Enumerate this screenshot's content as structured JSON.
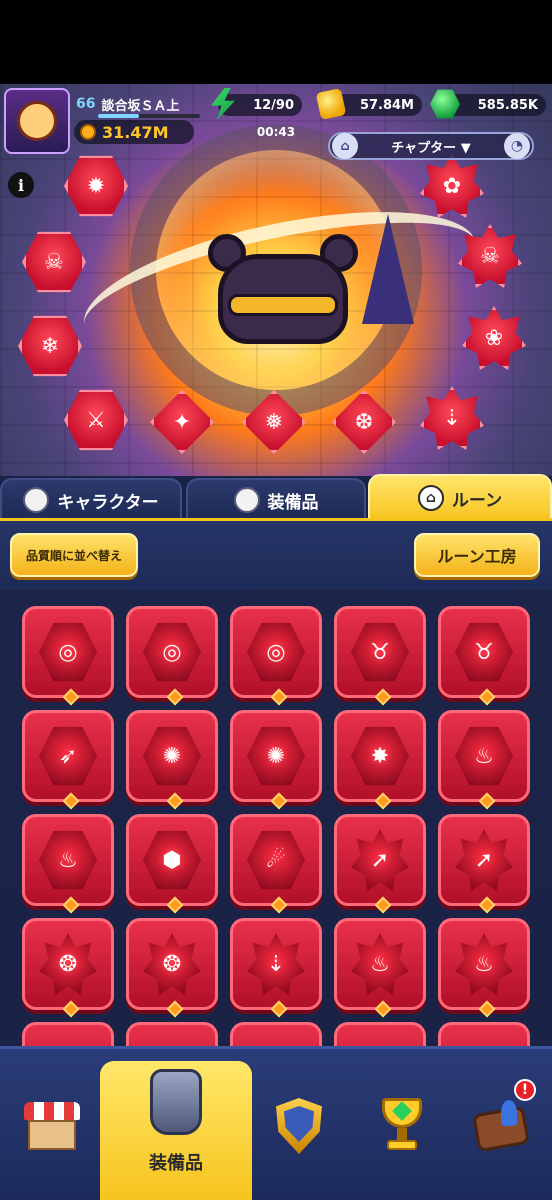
{
  "player": {
    "level": "66",
    "name": "談合坂ＳＡ上",
    "power": "31.47M"
  },
  "resources": {
    "energy": "12/90",
    "coins": "57.84M",
    "gems": "585.85K"
  },
  "timer": "00:43",
  "chapter_selector": {
    "label": "チャプター"
  },
  "tabs": [
    {
      "label": "キャラクター",
      "active": false
    },
    {
      "label": "装備品",
      "active": false
    },
    {
      "label": "ルーン",
      "active": true
    }
  ],
  "toolbar": {
    "sort_label": "品質順に並べ替え",
    "workshop_label": "ルーン工房"
  },
  "bottom_nav": {
    "items": [
      {
        "id": "shop",
        "icon": "shop-icon",
        "label": ""
      },
      {
        "id": "equipment",
        "icon": "armor-icon",
        "label": "装備品",
        "active": true
      },
      {
        "id": "guild",
        "icon": "shield-icon",
        "label": ""
      },
      {
        "id": "trophy",
        "icon": "trophy-icon",
        "label": ""
      },
      {
        "id": "events",
        "icon": "event-icon",
        "label": "",
        "badge": "!"
      }
    ]
  },
  "colors": {
    "rune_red": "#d8183a",
    "accent_yellow": "#f7c41f",
    "panel_blue": "#1c2449"
  }
}
